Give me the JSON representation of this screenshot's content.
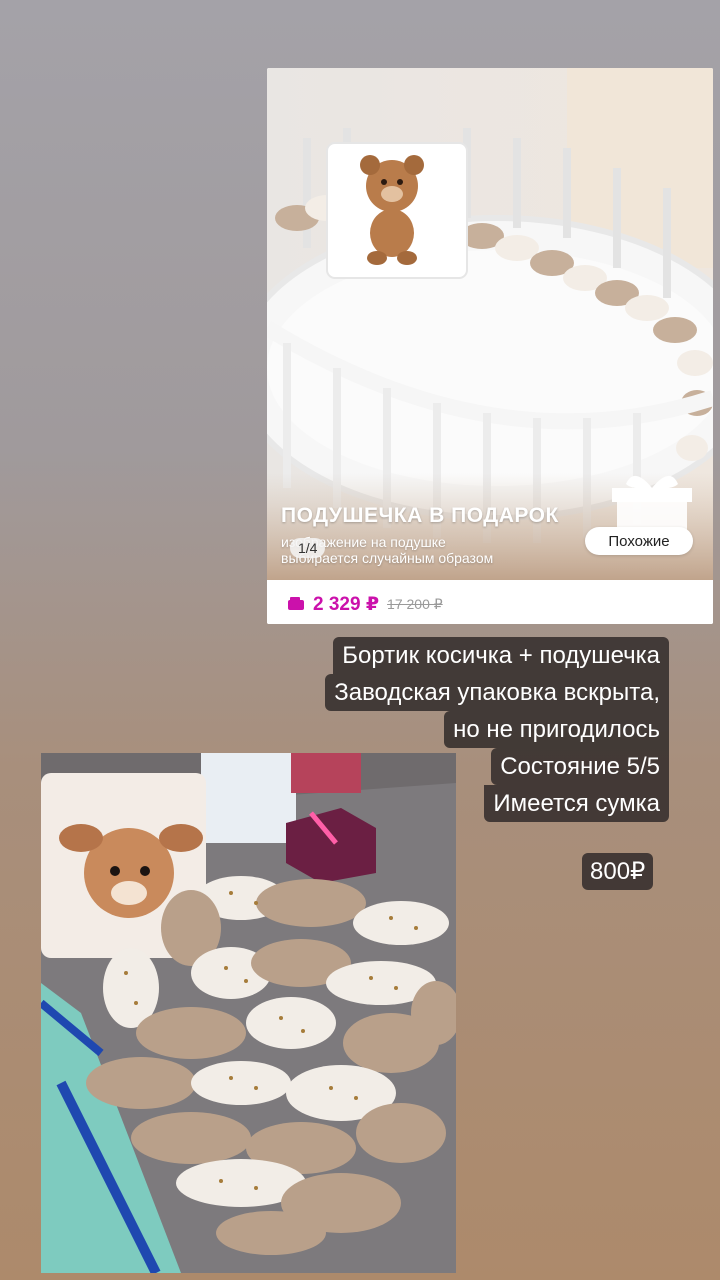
{
  "product_card": {
    "banner_title": "ПОДУШЕЧКА В ПОДАРОК",
    "banner_subtitle_line1": "изображение на подушке",
    "banner_subtitle_line2": "выбирается случайным образом",
    "image_counter": "1/4",
    "similar_button": "Похожие",
    "price": "2 329 ₽",
    "old_price": "17 200 ₽"
  },
  "caption": {
    "lines": [
      "Бортик косичка + подушечка",
      "Заводская упаковка вскрыта,",
      "но не пригодилось",
      "Состояние 5/5",
      "Имеется сумка"
    ],
    "price": "800₽"
  },
  "colors": {
    "accent_price": "#cb11ab",
    "caption_bg": "#342e2c"
  }
}
